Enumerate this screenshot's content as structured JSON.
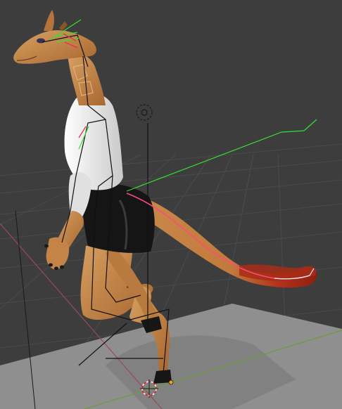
{
  "app": "3D viewport",
  "viewport": {
    "background": "#3d3d3d",
    "grid_color": "#4a4a4a",
    "x_axis_color": "#9a4a55",
    "y_axis_color": "#6e9a3c",
    "floor_color": "#8c8c8c"
  },
  "character": {
    "fur_color": "#c98a4c",
    "spot_color": "#b06a2a",
    "shirt_color": "#e8e8e8",
    "skirt_color": "#141414",
    "tail_tip_color": "#b3321a",
    "hoof_color": "#161616"
  },
  "armature": {
    "bone_color": "#111111",
    "ik_line_color": "#34e034",
    "selected_bone_color": "#ff4b7a",
    "highlight_bone_color": "#ffffff"
  },
  "icons": [
    "3d-cursor-icon",
    "object-origin-icon",
    "empty-target-icon"
  ]
}
